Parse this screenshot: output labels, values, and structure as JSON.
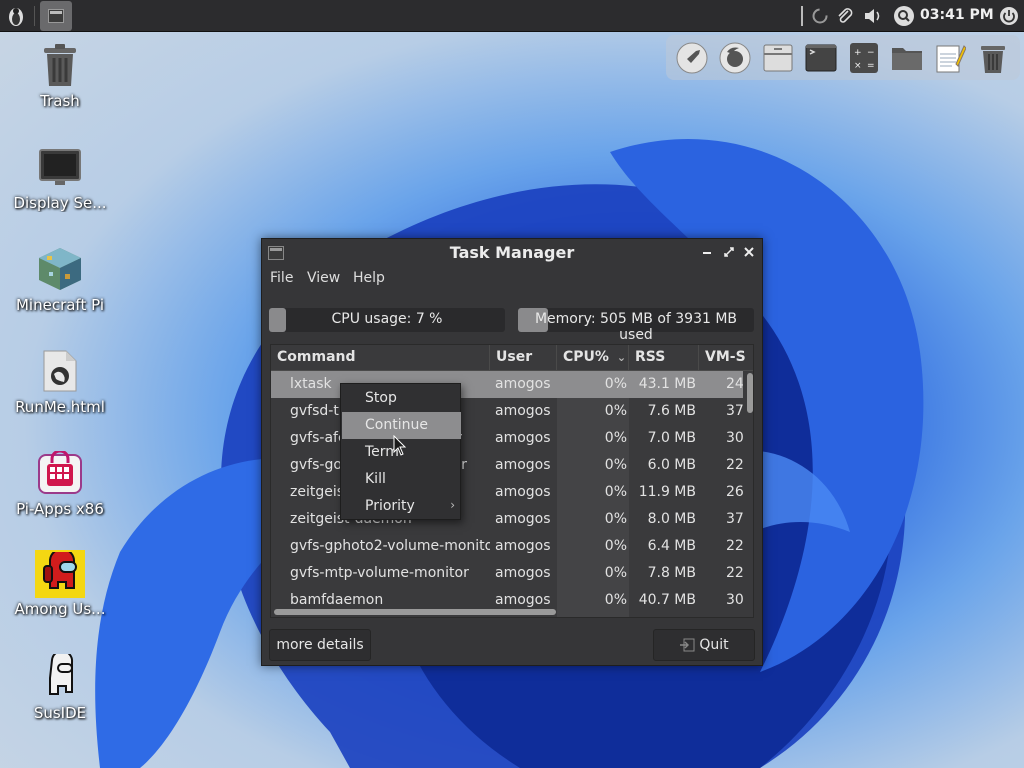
{
  "panel": {
    "clock": "03:41 PM",
    "icons": [
      "app-menu-icon",
      "window-button-icon",
      "spinner-icon",
      "paperclip-icon",
      "volume-icon",
      "search-icon",
      "power-icon"
    ]
  },
  "desktop_icons": [
    {
      "label": "Trash",
      "icon": "trash-icon"
    },
    {
      "label": "Display Se...",
      "icon": "monitor-icon"
    },
    {
      "label": "Minecraft Pi",
      "icon": "minecraft-icon"
    },
    {
      "label": "RunMe.html",
      "icon": "html-file-icon"
    },
    {
      "label": "Pi-Apps x86",
      "icon": "pi-apps-icon"
    },
    {
      "label": "Among Us...",
      "icon": "among-us-icon"
    },
    {
      "label": "SusIDE",
      "icon": "suside-icon"
    }
  ],
  "dock": {
    "items": [
      "rocket-launcher-icon",
      "firefox-icon",
      "file-cabinet-icon",
      "terminal-icon",
      "calculator-icon",
      "file-manager-icon",
      "text-editor-icon",
      "trash-icon"
    ]
  },
  "window": {
    "title": "Task Manager",
    "menu": [
      "File",
      "View",
      "Help"
    ],
    "cpu_text": "CPU usage: 7 %",
    "cpu_fraction": 0.07,
    "mem_text": "Memory: 505 MB of 3931 MB used",
    "mem_fraction": 0.128,
    "columns": [
      "Command",
      "User",
      "CPU%",
      "RSS",
      "VM-S"
    ],
    "sort_indicator": "⌄",
    "rows": [
      {
        "command": "lxtask",
        "user": "amogos",
        "cpu": "0%",
        "rss": "43.1 MB",
        "vms": "24"
      },
      {
        "command": "gvfsd-trash",
        "user": "amogos",
        "cpu": "0%",
        "rss": "7.6 MB",
        "vms": "37"
      },
      {
        "command": "gvfs-afc-volume-monitor",
        "user": "amogos",
        "cpu": "0%",
        "rss": "7.0 MB",
        "vms": "30"
      },
      {
        "command": "gvfs-goa-volume-monitor",
        "user": "amogos",
        "cpu": "0%",
        "rss": "6.0 MB",
        "vms": "22"
      },
      {
        "command": "zeitgeist-fts",
        "user": "amogos",
        "cpu": "0%",
        "rss": "11.9 MB",
        "vms": "26"
      },
      {
        "command": "zeitgeist-daemon",
        "user": "amogos",
        "cpu": "0%",
        "rss": "8.0 MB",
        "vms": "37"
      },
      {
        "command": "gvfs-gphoto2-volume-monitor",
        "user": "amogos",
        "cpu": "0%",
        "rss": "6.4 MB",
        "vms": "22"
      },
      {
        "command": "gvfs-mtp-volume-monitor",
        "user": "amogos",
        "cpu": "0%",
        "rss": "7.8 MB",
        "vms": "22"
      },
      {
        "command": "bamfdaemon",
        "user": "amogos",
        "cpu": "0%",
        "rss": "40.7 MB",
        "vms": "30"
      }
    ],
    "more_details_label": "more details",
    "quit_label": "Quit"
  },
  "context_menu": {
    "items": [
      {
        "label": "Stop"
      },
      {
        "label": "Continue"
      },
      {
        "label": "Term"
      },
      {
        "label": "Kill"
      },
      {
        "label": "Priority"
      }
    ],
    "submenu_arrow": "›"
  }
}
